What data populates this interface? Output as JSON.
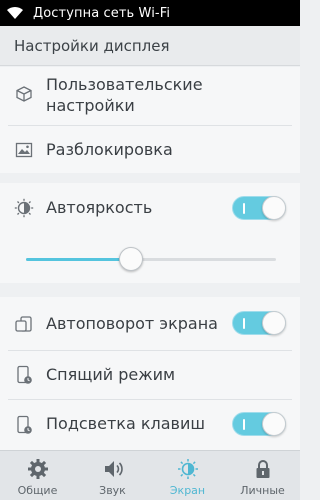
{
  "status_bar": {
    "text": "Доступна сеть Wi-Fi",
    "icon": "wifi-icon"
  },
  "header": {
    "title": "Настройки дисплея"
  },
  "items": {
    "custom": {
      "label_line1": "Пользовательские",
      "label_line2": "настройки",
      "icon": "cube-icon"
    },
    "unlock": {
      "label": "Разблокировка",
      "icon": "picture-icon"
    },
    "autobrightness": {
      "label": "Автояркость",
      "icon": "brightness-icon",
      "enabled": true
    },
    "brightness_level": 0.42,
    "autorotate": {
      "label": "Автоповорот экрана",
      "icon": "rotate-icon",
      "enabled": true
    },
    "sleep": {
      "label": "Спящий режим",
      "icon": "phone-clock-icon"
    },
    "key_backlight": {
      "label": "Подсветка клавиш",
      "icon": "phone-clock-icon",
      "enabled": true
    }
  },
  "nav": [
    {
      "label": "Общие",
      "icon": "gear-icon",
      "active": false
    },
    {
      "label": "Звук",
      "icon": "speaker-icon",
      "active": false
    },
    {
      "label": "Экран",
      "icon": "brightness-icon",
      "active": true
    },
    {
      "label": "Личные",
      "icon": "lock-icon",
      "active": false
    }
  ],
  "colors": {
    "accent": "#54c4de",
    "status_bg": "#000000"
  }
}
